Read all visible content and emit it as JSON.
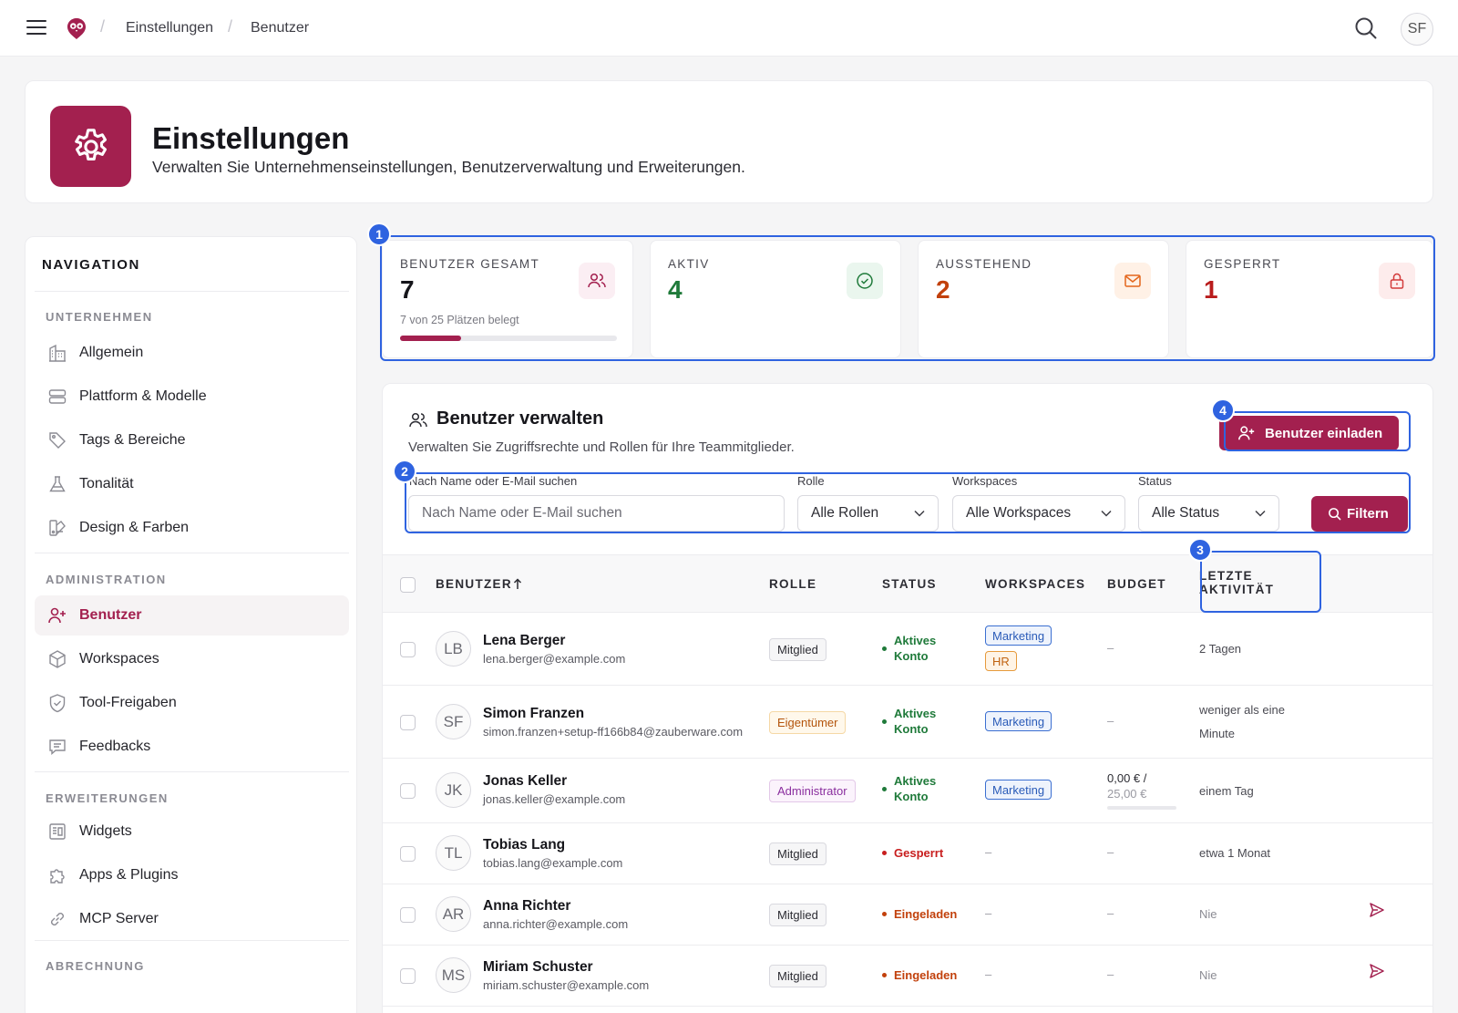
{
  "topbar": {
    "breadcrumb": [
      "Einstellungen",
      "Benutzer"
    ],
    "avatar": "SF"
  },
  "header": {
    "title": "Einstellungen",
    "subtitle": "Verwalten Sie Unternehmenseinstellungen, Benutzerverwaltung und Erweiterungen."
  },
  "nav": {
    "heading": "NAVIGATION",
    "groups": [
      {
        "label": "UNTERNEHMEN",
        "items": [
          {
            "label": "Allgemein",
            "icon": "building-icon"
          },
          {
            "label": "Plattform & Modelle",
            "icon": "server-icon"
          },
          {
            "label": "Tags & Bereiche",
            "icon": "tag-icon"
          },
          {
            "label": "Tonalität",
            "icon": "flask-icon"
          },
          {
            "label": "Design & Farben",
            "icon": "palette-icon"
          }
        ]
      },
      {
        "label": "ADMINISTRATION",
        "items": [
          {
            "label": "Benutzer",
            "icon": "user-plus-icon",
            "active": true
          },
          {
            "label": "Workspaces",
            "icon": "cube-icon"
          },
          {
            "label": "Tool-Freigaben",
            "icon": "shield-check-icon"
          },
          {
            "label": "Feedbacks",
            "icon": "message-icon"
          }
        ]
      },
      {
        "label": "ERWEITERUNGEN",
        "items": [
          {
            "label": "Widgets",
            "icon": "widget-icon"
          },
          {
            "label": "Apps & Plugins",
            "icon": "puzzle-icon"
          },
          {
            "label": "MCP Server",
            "icon": "link-icon"
          }
        ]
      },
      {
        "label": "ABRECHNUNG",
        "items": []
      }
    ]
  },
  "stats": [
    {
      "label": "BENUTZER GESAMT",
      "value": "7",
      "sub": "7 von 25 Plätzen belegt",
      "progress": 0.28,
      "color": "#16161b",
      "icon": "users-icon"
    },
    {
      "label": "AKTIV",
      "value": "4",
      "color": "#1f7a3a",
      "icon": "check-circle-icon"
    },
    {
      "label": "AUSSTEHEND",
      "value": "2",
      "color": "#c2410c",
      "icon": "mail-icon"
    },
    {
      "label": "GESPERRT",
      "value": "1",
      "color": "#b91c1c",
      "icon": "lock-icon"
    }
  ],
  "markers": [
    "1",
    "2",
    "3",
    "4"
  ],
  "users": {
    "title": "Benutzer verwalten",
    "subtitle": "Verwalten Sie Zugriffsrechte und Rollen für Ihre Teammitglieder.",
    "invite_label": "Benutzer einladen",
    "filters": {
      "search_label": "Nach Name oder E-Mail suchen",
      "search_placeholder": "Nach Name oder E-Mail suchen",
      "role_label": "Rolle",
      "role_value": "Alle Rollen",
      "workspace_label": "Workspaces",
      "workspace_value": "Alle Workspaces",
      "status_label": "Status",
      "status_value": "Alle Status",
      "filter_button": "Filtern"
    },
    "columns": {
      "user": "BENUTZER",
      "role": "ROLLE",
      "status": "STATUS",
      "workspaces": "WORKSPACES",
      "budget": "BUDGET",
      "activity_1": "LETZTE",
      "activity_2": "AKTIVITÄT"
    },
    "rows": [
      {
        "initials": "LB",
        "name": "Lena Berger",
        "email": "lena.berger@example.com",
        "role": "Mitglied",
        "status_1": "Aktives",
        "status_2": "Konto",
        "workspaces": [
          "Marketing",
          "HR"
        ],
        "budget": "–",
        "activity_1": "2 Tagen"
      },
      {
        "initials": "SF",
        "name": "Simon Franzen",
        "email": "simon.franzen+setup-ff166b84@zauberware.com",
        "role": "Eigentümer",
        "status_1": "Aktives",
        "status_2": "Konto",
        "workspaces": [
          "Marketing"
        ],
        "budget": "–",
        "activity_1": "weniger als eine",
        "activity_2": "Minute"
      },
      {
        "initials": "JK",
        "name": "Jonas Keller",
        "email": "jonas.keller@example.com",
        "role": "Administrator",
        "status_1": "Aktives",
        "status_2": "Konto",
        "workspaces": [
          "Marketing"
        ],
        "budget_used": "0,00 € /",
        "budget_total": "25,00 €",
        "activity_1": "einem Tag"
      },
      {
        "initials": "TL",
        "name": "Tobias Lang",
        "email": "tobias.lang@example.com",
        "role": "Mitglied",
        "status_1": "Gesperrt",
        "ws_dash": "–",
        "budget": "–",
        "activity_1": "etwa 1 Monat"
      },
      {
        "initials": "AR",
        "name": "Anna Richter",
        "email": "anna.richter@example.com",
        "role": "Mitglied",
        "status_1": "Eingeladen",
        "ws_dash": "–",
        "budget": "–",
        "activity_1": "Nie"
      },
      {
        "initials": "MS",
        "name": "Miriam Schuster",
        "email": "miriam.schuster@example.com",
        "role": "Mitglied",
        "status_1": "Eingeladen",
        "ws_dash": "–",
        "budget": "–",
        "activity_1": "Nie"
      }
    ]
  },
  "colors": {
    "brand": "#a3204f",
    "highlight": "#2f63e0",
    "active": "#1f7a3a",
    "locked": "#c81e1e",
    "invited": "#c2410c"
  }
}
